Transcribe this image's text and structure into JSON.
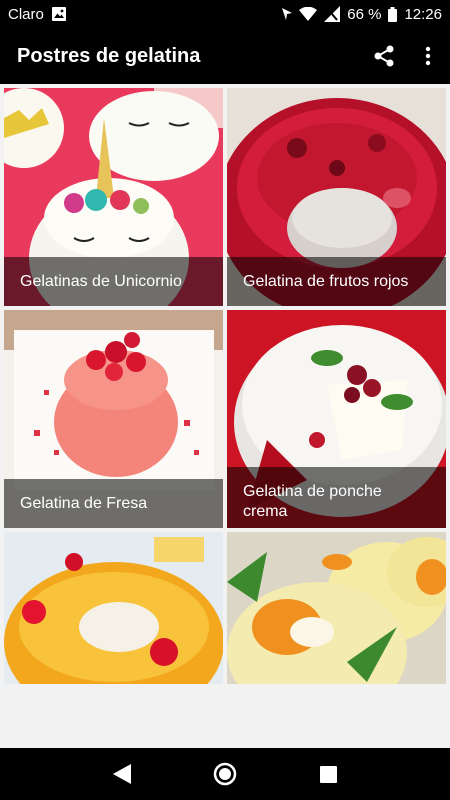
{
  "status": {
    "carrier": "Claro",
    "battery": "66 %",
    "time": "12:26"
  },
  "app_bar": {
    "title": "Postres de gelatina",
    "share_icon": "share-icon",
    "more_icon": "more-vert-icon"
  },
  "cards": [
    {
      "title": "Gelatinas de Unicornio"
    },
    {
      "title": "Gelatina de frutos rojos"
    },
    {
      "title": "Gelatina de Fresa"
    },
    {
      "title": "Gelatina de ponche crema"
    },
    {
      "title": ""
    },
    {
      "title": ""
    }
  ],
  "nav": {
    "back_icon": "back-icon",
    "home_icon": "home-icon",
    "recents_icon": "recents-icon"
  },
  "colors": {
    "bars": "#000000",
    "background": "#f2f2f2",
    "caption_overlay": "#0000008c"
  }
}
